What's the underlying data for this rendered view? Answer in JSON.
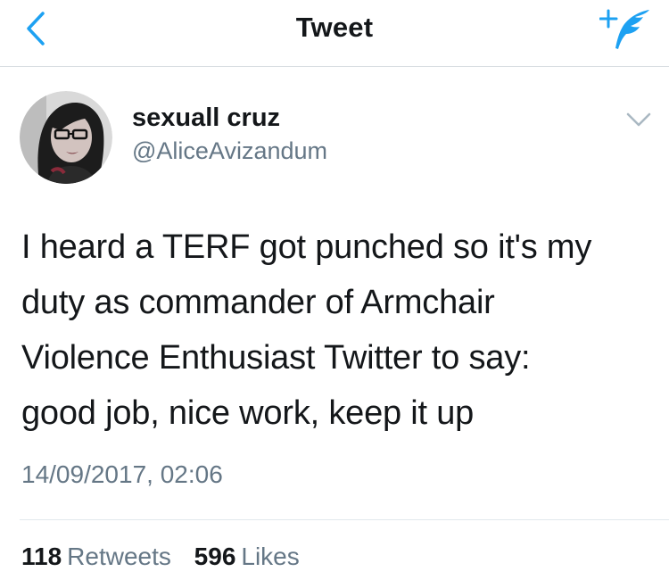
{
  "nav": {
    "title": "Tweet",
    "back_icon": "chevron-left-icon",
    "compose_icon": "compose-tweet-icon"
  },
  "tweet": {
    "author": {
      "display_name": "sexuall cruz",
      "handle": "@AliceAvizandum"
    },
    "text_lines": [
      "I heard a TERF got punched so it's my",
      "duty as commander of Armchair",
      "Violence Enthusiast Twitter to say:",
      "good job, nice work, keep it up"
    ],
    "timestamp": "14/09/2017, 02:06",
    "stats": {
      "retweets_count": "118",
      "retweets_label": "Retweets",
      "likes_count": "596",
      "likes_label": "Likes"
    }
  },
  "colors": {
    "accent": "#1da1f2",
    "text_primary": "#14171a",
    "text_secondary": "#657786",
    "divider": "#e1e8ed"
  }
}
